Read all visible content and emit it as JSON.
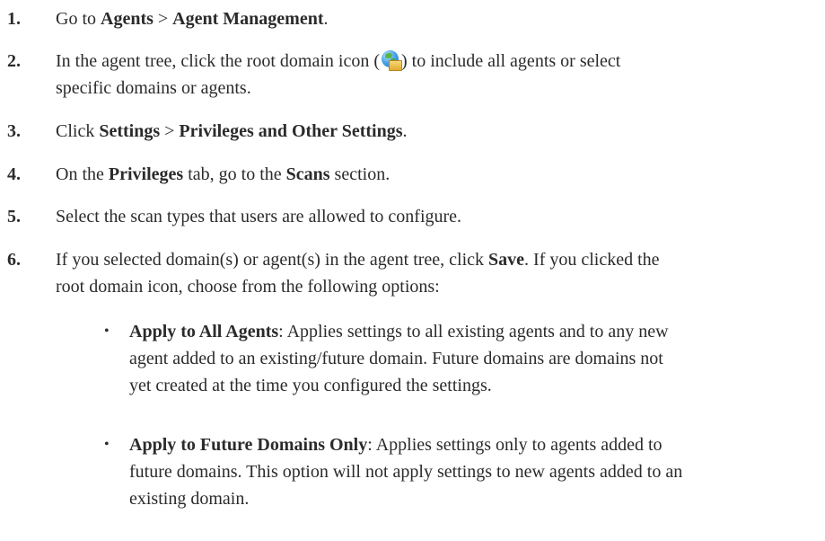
{
  "steps": [
    {
      "number": "1.",
      "parts": [
        "Go to ",
        "Agents",
        " > ",
        "Agent Management",
        "."
      ]
    },
    {
      "number": "2.",
      "parts": [
        "In the agent tree, click the root domain icon (",
        ") to include all agents or select",
        "specific domains or agents."
      ],
      "icon": "root-domain-globe-icon"
    },
    {
      "number": "3.",
      "parts": [
        "Click ",
        "Settings",
        " > ",
        "Privileges and Other Settings",
        "."
      ]
    },
    {
      "number": "4.",
      "parts": [
        "On the ",
        "Privileges",
        " tab, go to the ",
        "Scans",
        " section."
      ]
    },
    {
      "number": "5.",
      "parts": [
        "Select the scan types that users are allowed to configure."
      ]
    },
    {
      "number": "6.",
      "parts": [
        "If you selected domain(s) or agent(s) in the agent tree, click ",
        "Save",
        ". If you clicked the",
        "root domain icon, choose from the following options:"
      ]
    }
  ],
  "options": [
    {
      "bullet": "•",
      "title": "Apply to All Agents",
      "lines": [
        ": Applies settings to all existing agents and to any new",
        "agent added to an existing/future domain. Future domains are domains not",
        "yet created at the time you configured the settings."
      ]
    },
    {
      "bullet": "•",
      "title": "Apply to Future Domains Only",
      "lines": [
        ": Applies settings only to agents added to",
        "future domains. This option will not apply settings to new agents added to an",
        "existing domain."
      ]
    }
  ]
}
